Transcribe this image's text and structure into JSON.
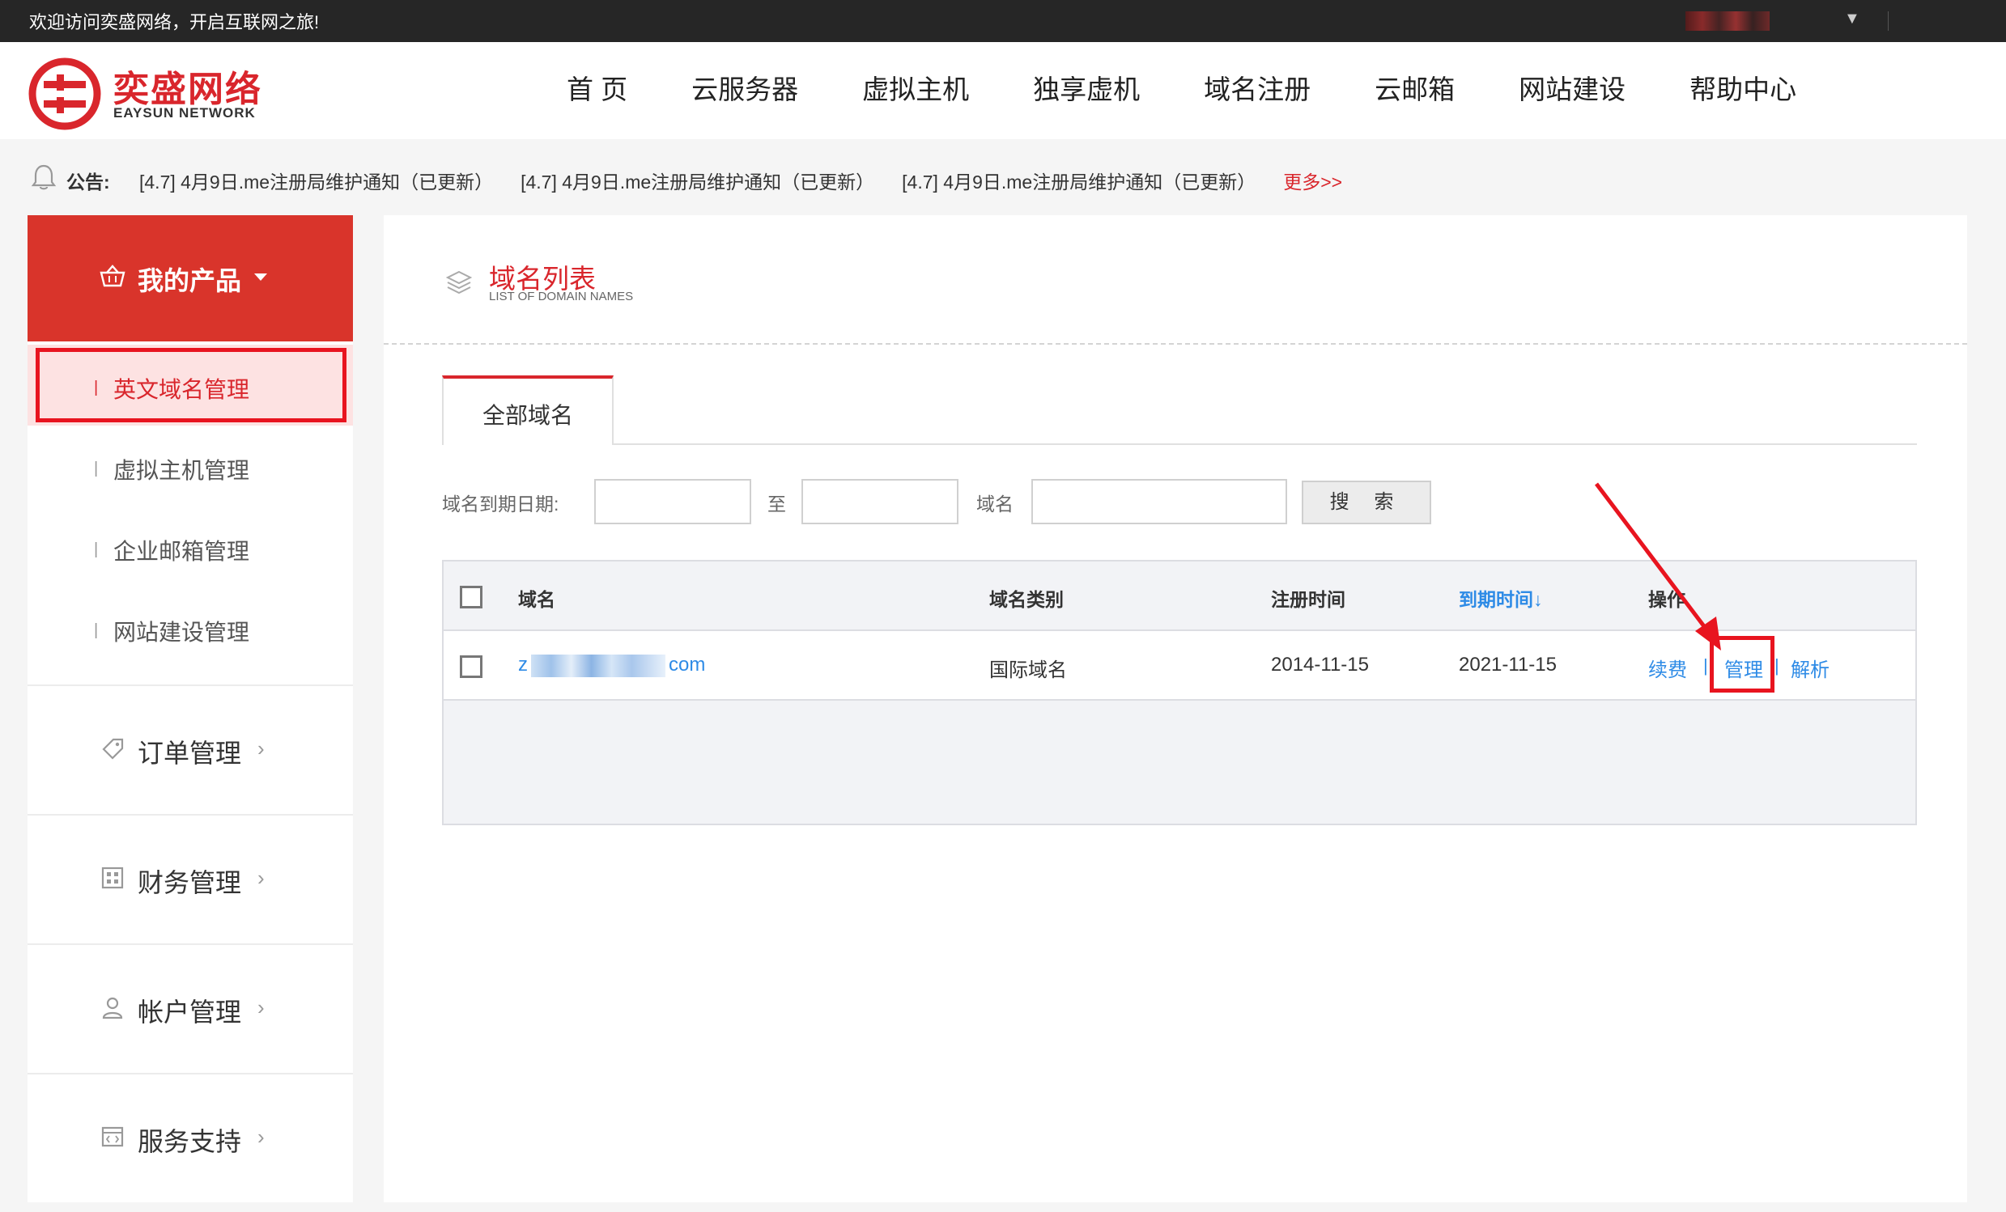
{
  "topbar": {
    "welcome": "欢迎访问奕盛网络，开启互联网之旅!",
    "user_caret": "▼"
  },
  "brand": {
    "name_cn": "奕盛网络",
    "name_en": "EAYSUN NETWORK",
    "color": "#d9262c"
  },
  "nav": {
    "items": [
      "首 页",
      "云服务器",
      "虚拟主机",
      "独享虚机",
      "域名注册",
      "云邮箱",
      "网站建设",
      "帮助中心"
    ]
  },
  "notice": {
    "label": "公告:",
    "items": [
      "[4.7] 4月9日.me注册局维护通知（已更新）",
      "[4.7] 4月9日.me注册局维护通知（已更新）",
      "[4.7] 4月9日.me注册局维护通知（已更新）"
    ],
    "more": "更多>>"
  },
  "sidebar": {
    "header": "我的产品",
    "sub_items": [
      "英文域名管理",
      "虚拟主机管理",
      "企业邮箱管理",
      "网站建设管理"
    ],
    "sections": [
      {
        "label": "订单管理",
        "icon": "tag-icon"
      },
      {
        "label": "财务管理",
        "icon": "grid-icon"
      },
      {
        "label": "帐户管理",
        "icon": "user-icon"
      },
      {
        "label": "服务支持",
        "icon": "code-window-icon"
      }
    ],
    "chevron": "›",
    "divider": "|"
  },
  "main": {
    "title": "域名列表",
    "subtitle": "LIST OF DOMAIN NAMES",
    "tab": "全部域名",
    "filter": {
      "expire_label": "域名到期日期:",
      "to_label": "至",
      "domain_label": "域名",
      "search_button": "搜 索"
    },
    "table": {
      "headers": {
        "domain": "域名",
        "type": "域名类别",
        "registered": "注册时间",
        "expires": "到期时间↓",
        "actions": "操作"
      },
      "rows": [
        {
          "domain_prefix": "z",
          "domain_suffix": "com",
          "type": "国际域名",
          "registered": "2014-11-15",
          "expires": "2021-11-15",
          "renew": "续费",
          "manage": "管理",
          "resolve": "解析",
          "sep": "|"
        }
      ]
    }
  },
  "colors": {
    "accent_red": "#d9262c",
    "link_blue": "#2e8be6",
    "highlight_box": "#e8141f"
  }
}
